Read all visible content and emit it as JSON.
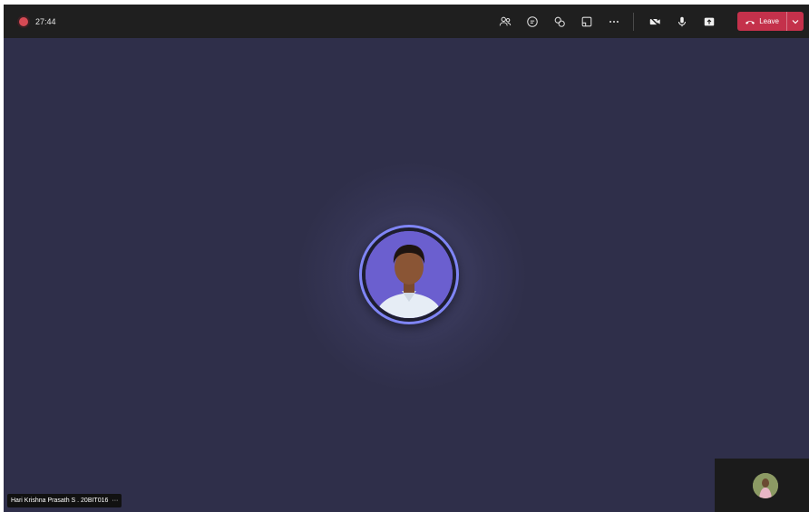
{
  "meeting": {
    "recording_icon": "record-dot-icon",
    "elapsed_time": "27:44"
  },
  "toolbar": {
    "icons": [
      "people-icon",
      "chat-icon",
      "reactions-icon",
      "rooms-icon",
      "more-icon",
      "camera-off-icon",
      "mic-icon",
      "share-icon"
    ],
    "leave_label": "Leave",
    "leave_color": "#c4314b"
  },
  "participant": {
    "name_tag": "Hari Krishna Prasath S . 20BIT016",
    "more_glyph": "···",
    "ring_color": "#7f85f5"
  },
  "colors": {
    "stage_background": "#2f2f4a",
    "topbar_background": "#1f1f1f"
  }
}
